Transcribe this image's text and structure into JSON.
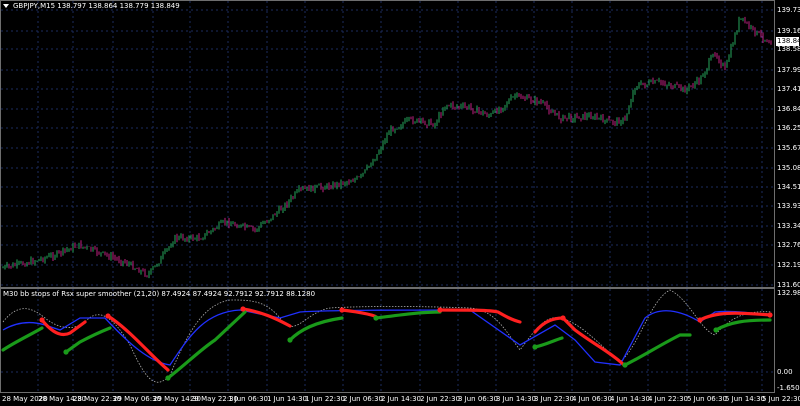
{
  "main_title": "GBPJPY,M15  138.797 138.864 138.779 138.849",
  "current_price": "138.849",
  "indicator_title": "M30 bb stops of Rsx super smoother (21,20) 87.4924 87.4924 92.7912 92.7912 88.1280",
  "price_ticks": [
    "139.735",
    "139.165",
    "138.580",
    "137.995",
    "137.410",
    "136.840",
    "136.255",
    "135.670",
    "135.085",
    "134.515",
    "133.930",
    "133.345",
    "132.760",
    "132.190",
    "131.605"
  ],
  "indicator_ticks": [
    "132.9885",
    "0.00",
    "-1.6503"
  ],
  "time_ticks": [
    "28 May 2020",
    "28 May 14:30",
    "28 May 22:30",
    "29 May 06:30",
    "29 May 14:30",
    "29 May 22:30",
    "1 Jun 06:30",
    "1 Jun 14:30",
    "1 Jun 22:30",
    "2 Jun 06:30",
    "2 Jun 14:30",
    "2 Jun 22:30",
    "3 Jun 06:30",
    "3 Jun 14:30",
    "3 Jun 22:30",
    "4 Jun 06:30",
    "4 Jun 14:30",
    "4 Jun 22:30",
    "5 Jun 06:30",
    "5 Jun 14:30",
    "5 Jun 22:30"
  ],
  "colors": {
    "background": "#000000",
    "grid": "#1c2b5e",
    "bull": "#26a65b",
    "bear": "#c02080",
    "ind_red": "#ff2020",
    "ind_green": "#1a9a1a",
    "ind_blue": "#2030ff",
    "ind_dot": "#b0b0b0"
  }
}
